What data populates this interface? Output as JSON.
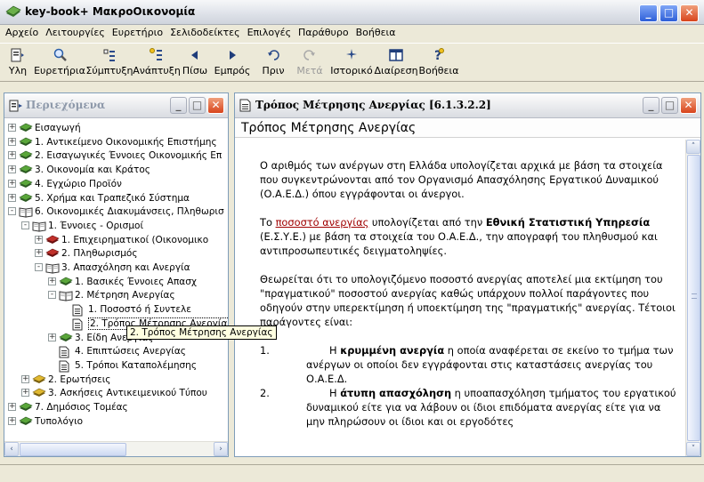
{
  "window": {
    "title": "key-book+  ΜακροΟικονομία"
  },
  "menu": [
    "Αρχείο",
    "Λειτουργίες",
    "Ευρετήριο",
    "Σελιδοδείκτες",
    "Επιλογές",
    "Παράθυρο",
    "Βοήθεια"
  ],
  "toolbar": [
    {
      "label": "Υλη",
      "icon": "contents-icon",
      "disabled": false
    },
    {
      "label": "Ευρετήρια",
      "icon": "search-icon",
      "disabled": false
    },
    {
      "label": "Σύμπτυξη",
      "icon": "collapse-icon",
      "disabled": false
    },
    {
      "label": "Ανάπτυξη",
      "icon": "expand-icon",
      "disabled": false
    },
    {
      "label": "Πίσω",
      "icon": "back-arrow-icon",
      "disabled": false
    },
    {
      "label": "Εμπρός",
      "icon": "forward-arrow-icon",
      "disabled": false
    },
    {
      "label": "Πριν",
      "icon": "undo-icon",
      "disabled": false
    },
    {
      "label": "Μετά",
      "icon": "redo-icon",
      "disabled": true
    },
    {
      "label": "Ιστορικό",
      "icon": "history-icon",
      "disabled": false
    },
    {
      "label": "Διαίρεση",
      "icon": "split-view-icon",
      "disabled": false
    },
    {
      "label": "Βοήθεια",
      "icon": "help-icon",
      "disabled": false
    }
  ],
  "left_panel": {
    "title": "Περιεχόμενα",
    "tree": [
      {
        "level": 0,
        "toggle": "+",
        "icon": "book",
        "label": "Εισαγωγή"
      },
      {
        "level": 0,
        "toggle": "+",
        "icon": "book",
        "label": "1. Αντικείμενο Οικονομικής Επιστήμης"
      },
      {
        "level": 0,
        "toggle": "+",
        "icon": "book",
        "label": "2. Εισαγωγικές Έννοιες Οικονομικής Επ"
      },
      {
        "level": 0,
        "toggle": "+",
        "icon": "book",
        "label": "3. Οικονομία και Κράτος"
      },
      {
        "level": 0,
        "toggle": "+",
        "icon": "book",
        "label": "4. Εγχώριο Προϊόν"
      },
      {
        "level": 0,
        "toggle": "+",
        "icon": "book",
        "label": "5. Χρήμα και Τραπεζικό Σύστημα"
      },
      {
        "level": 0,
        "toggle": "-",
        "icon": "open-book",
        "label": "6. Οικονομικές Διακυμάνσεις, Πληθωρισ"
      },
      {
        "level": 1,
        "toggle": "-",
        "icon": "open-book",
        "label": "1. Έννοιες - Ορισμοί"
      },
      {
        "level": 2,
        "toggle": "+",
        "icon": "book-red",
        "label": "1. Επιχειρηματικοί (Οικονομικο"
      },
      {
        "level": 2,
        "toggle": "+",
        "icon": "book-red",
        "label": "2. Πληθωρισμός"
      },
      {
        "level": 2,
        "toggle": "-",
        "icon": "open-book",
        "label": "3. Απασχόληση και Ανεργία"
      },
      {
        "level": 3,
        "toggle": "+",
        "icon": "book",
        "label": "1. Βασικές Έννοιες Απασχ"
      },
      {
        "level": 3,
        "toggle": "-",
        "icon": "open-book",
        "label": "2. Μέτρηση Ανεργίας"
      },
      {
        "level": 4,
        "toggle": "",
        "icon": "page",
        "label": "1. Ποσοστό ή Συντελε"
      },
      {
        "level": 4,
        "toggle": "",
        "icon": "page",
        "label": "2. Τρόπος Μέτρησης Ανεργίας",
        "selected": true
      },
      {
        "level": 3,
        "toggle": "+",
        "icon": "book",
        "label": "3. Είδη Ανεργίας"
      },
      {
        "level": 3,
        "toggle": "",
        "icon": "page",
        "label": "4. Επιπτώσεις Ανεργίας"
      },
      {
        "level": 3,
        "toggle": "",
        "icon": "page",
        "label": "5. Τρόποι Καταπολέμησης"
      },
      {
        "level": 1,
        "toggle": "+",
        "icon": "book-yellow",
        "label": "2. Ερωτήσεις"
      },
      {
        "level": 1,
        "toggle": "+",
        "icon": "book-yellow",
        "label": "3. Ασκήσεις Αντικειμενικού Τύπου"
      },
      {
        "level": 0,
        "toggle": "+",
        "icon": "book",
        "label": "7. Δημόσιος Τομέας"
      },
      {
        "level": 0,
        "toggle": "+",
        "icon": "book",
        "label": "Τυπολόγιο"
      }
    ],
    "tooltip": "2. Τρόπος Μέτρησης Ανεργίας"
  },
  "right_panel": {
    "title": "Τρόπος Μέτρησης Ανεργίας   [6.1.3.2.2]",
    "heading": "Τρόπος Μέτρησης Ανεργίας",
    "p1": "Ο αριθμός των ανέργων στη Ελλάδα υπολογίζεται αρχικά με βάση τα στοιχεία που συγκεντρώνονται από τον Οργανισμό Απασχόλησης Εργατικού Δυναμικού (Ο.Α.Ε.Δ.) όπου εγγράφονται οι άνεργοι.",
    "p2_a": "Το ",
    "p2_link": "ποσοστό ανεργίας",
    "p2_b": " υπολογίζεται από την ",
    "p2_bold": "Εθνική Στατιστική Υπηρεσία",
    "p2_c": " (Ε.Σ.Υ.Ε.) με βάση τα στοιχεία του Ο.Α.Ε.Δ., την απογραφή του πληθυσμού και αντιπροσωπευτικές δειγματοληψίες.",
    "p3": "Θεωρείται ότι το υπολογιζόμενο ποσοστό ανεργίας αποτελεί μια εκτίμηση του \"πραγματικού\" ποσοστού ανεργίας καθώς υπάρχουν πολλοί παράγοντες που οδηγούν στην υπερεκτίμηση ή υποεκτίμηση της \"πραγματικής\" ανεργίας. Τέτοιοι παράγοντες είναι:",
    "list": [
      {
        "num": "1.",
        "pre": "Η ",
        "bold": "κρυμμένη ανεργία",
        "text": " η οποία αναφέρεται σε εκείνο το τμήμα των ανέργων οι οποίοι δεν εγγράφονται στις καταστάσεις ανεργίας του Ο.Α.Ε.Δ."
      },
      {
        "num": "2.",
        "pre": "Η ",
        "bold": "άτυπη απασχόληση",
        "text": " η υποαπασχόληση τμήματος του εργατικού δυναμικού είτε για να λάβουν οι ίδιοι επιδόματα ανεργίας είτε για να μην πληρώσουν οι ίδιοι και οι εργοδότες"
      }
    ]
  }
}
